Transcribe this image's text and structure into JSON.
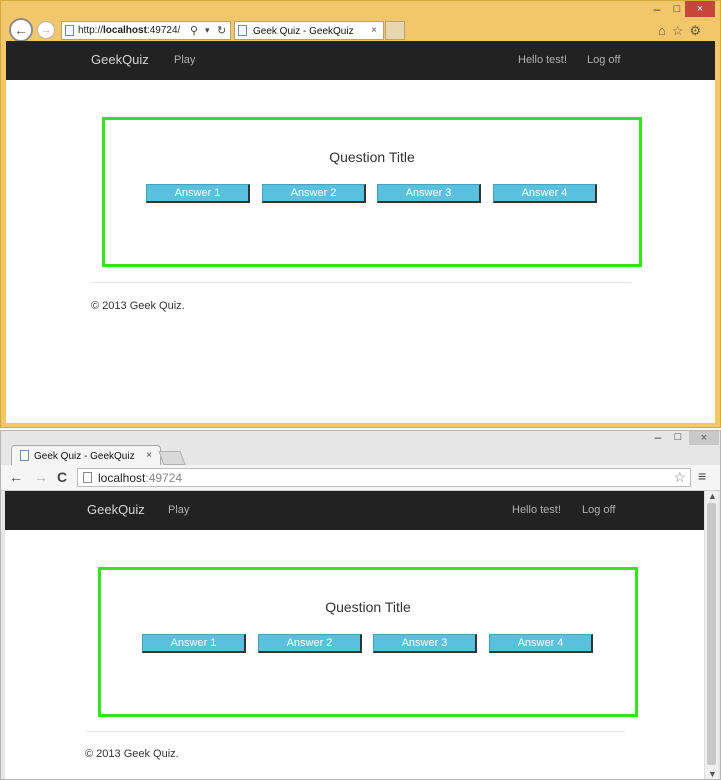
{
  "ie": {
    "address_prefix": "http://",
    "address_host": "localhost",
    "address_suffix": ":49724/",
    "tab_title": "Geek Quiz - GeekQuiz",
    "tab_close": "×",
    "min": "–",
    "max": "□",
    "close": "×"
  },
  "chrome": {
    "tab_title": "Geek Quiz - GeekQuiz",
    "tab_close": "×",
    "url_host": "localhost",
    "url_port": ":49724",
    "min": "–",
    "max": "□",
    "close": "×"
  },
  "site": {
    "brand": "GeekQuiz",
    "nav_play": "Play",
    "greeting": "Hello test!",
    "logoff": "Log off",
    "question_title": "Question Title",
    "answers": [
      "Answer 1",
      "Answer 2",
      "Answer 3",
      "Answer 4"
    ],
    "footer": "© 2013 Geek Quiz."
  },
  "colors": {
    "navbar": "#222222",
    "answer_button": "#5bc0de",
    "quiz_border": "#33e51c",
    "ie_frame": "#f2c76b"
  }
}
